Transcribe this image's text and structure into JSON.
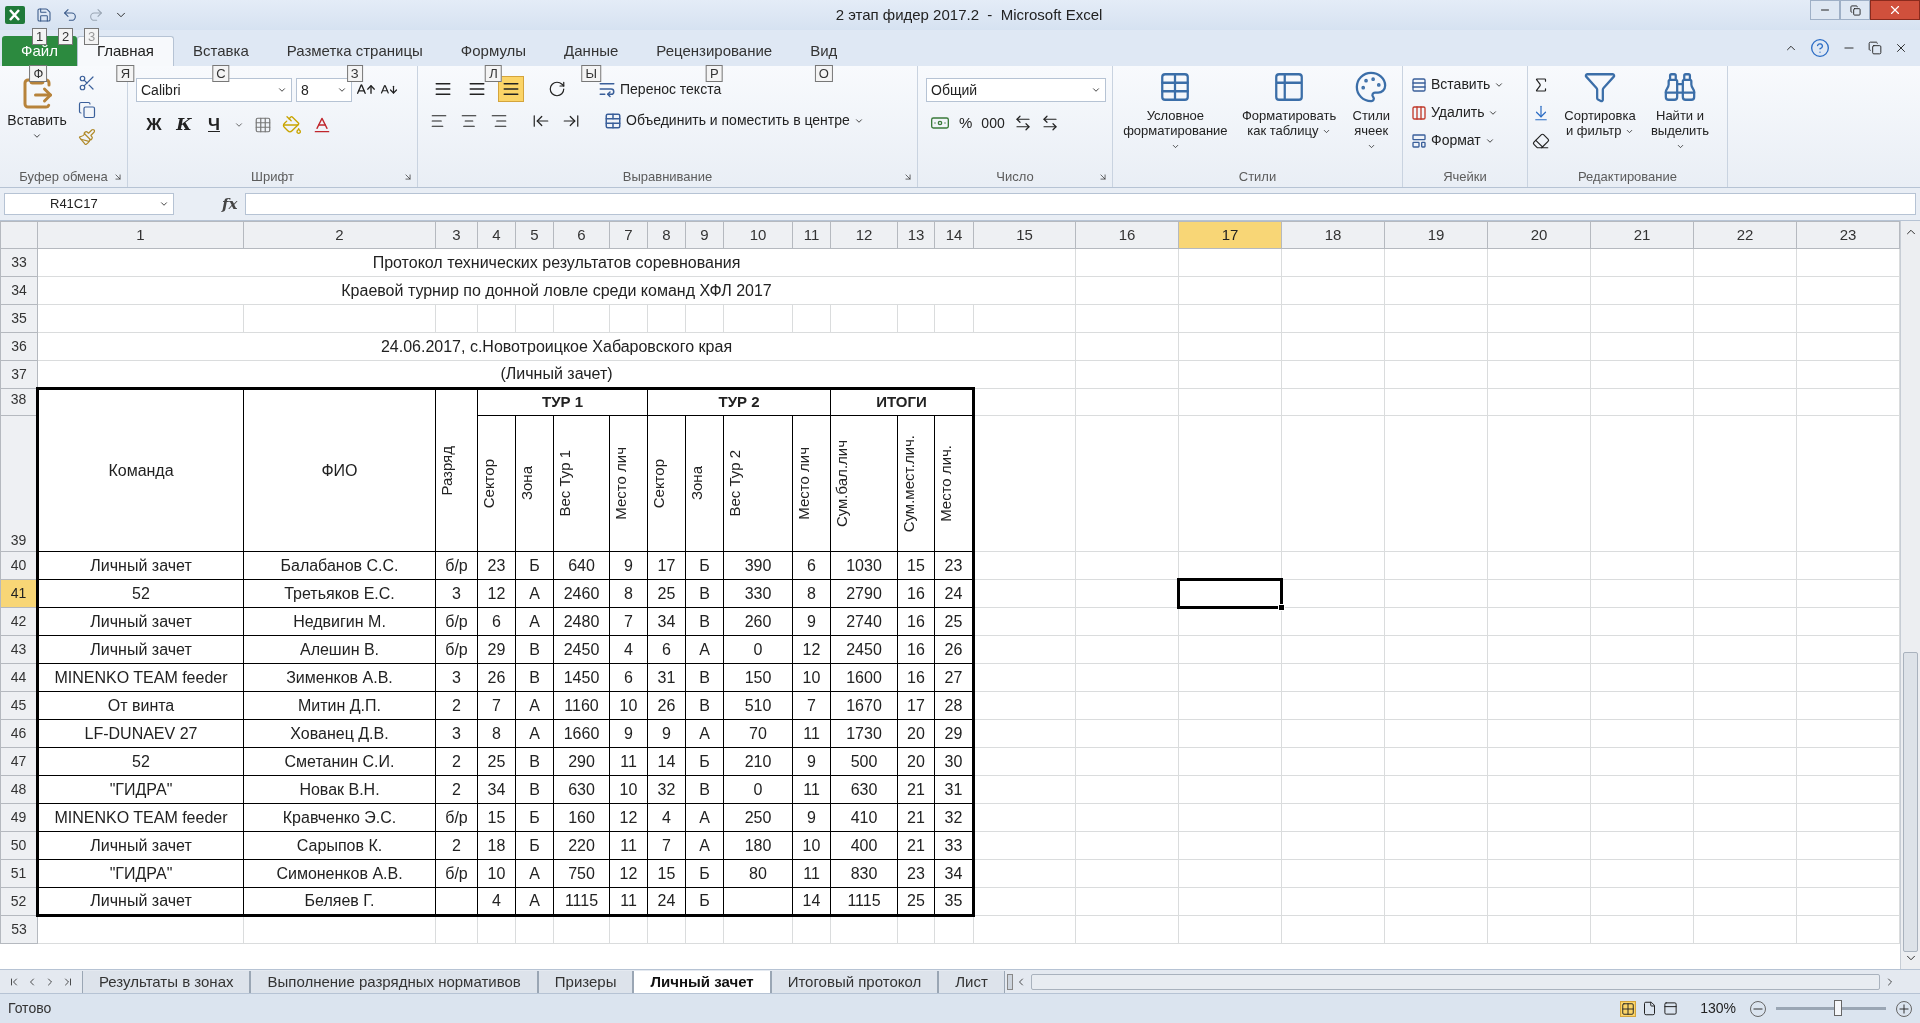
{
  "window": {
    "title": "2 этап фидер 2017.2  -  Microsoft Excel",
    "quick_access_keytips": [
      "1",
      "2",
      "3"
    ]
  },
  "ribbon_tabs": [
    {
      "label": "Файл",
      "keytip": "Ф",
      "kind": "file",
      "selected": false
    },
    {
      "label": "Главная",
      "keytip": "Я",
      "kind": "tab",
      "selected": true
    },
    {
      "label": "Вставка",
      "keytip": "С",
      "kind": "tab",
      "selected": false
    },
    {
      "label": "Разметка страницы",
      "keytip": "З",
      "kind": "tab",
      "selected": false
    },
    {
      "label": "Формулы",
      "keytip": "Л",
      "kind": "tab",
      "selected": false
    },
    {
      "label": "Данные",
      "keytip": "Ы",
      "kind": "tab",
      "selected": false
    },
    {
      "label": "Рецензирование",
      "keytip": "Р",
      "kind": "tab",
      "selected": false
    },
    {
      "label": "Вид",
      "keytip": "О",
      "kind": "tab",
      "selected": false
    }
  ],
  "ribbon": {
    "clipboard": {
      "paste": "Вставить",
      "group": "Буфер обмена"
    },
    "font": {
      "name": "Calibri",
      "size": "8",
      "bold": "Ж",
      "italic": "К",
      "underline": "Ч",
      "group": "Шрифт"
    },
    "alignment": {
      "valign_buttons": [
        {
          "selected": false
        },
        {
          "selected": false
        },
        {
          "selected": true
        }
      ],
      "wrap_text": "Перенос текста",
      "merge": "Объединить и поместить в центре",
      "group": "Выравнивание"
    },
    "number": {
      "format": "Общий",
      "percent": "%",
      "thousands": "000",
      "group": "Число"
    },
    "styles": {
      "buttons": [
        "Условное форматирование",
        "Форматировать как таблицу",
        "Стили ячеек"
      ],
      "group": "Стили"
    },
    "cells": {
      "buttons": [
        "Вставить",
        "Удалить",
        "Формат"
      ],
      "group": "Ячейки"
    },
    "editing": {
      "buttons": [
        "Сортировка и фильтр",
        "Найти и выделить"
      ],
      "group": "Редактирование"
    }
  },
  "formula_bar": {
    "name_box": "R41C17",
    "function_label": "fx"
  },
  "sheet": {
    "columns": [
      {
        "label": "1",
        "selected": false
      },
      {
        "label": "2",
        "selected": false
      },
      {
        "label": "3",
        "selected": false
      },
      {
        "label": "4",
        "selected": false
      },
      {
        "label": "5",
        "selected": false
      },
      {
        "label": "6",
        "selected": false
      },
      {
        "label": "7",
        "selected": false
      },
      {
        "label": "8",
        "selected": false
      },
      {
        "label": "9",
        "selected": false
      },
      {
        "label": "10",
        "selected": false
      },
      {
        "label": "11",
        "selected": false
      },
      {
        "label": "12",
        "selected": false
      },
      {
        "label": "13",
        "selected": false
      },
      {
        "label": "14",
        "selected": false
      },
      {
        "label": "15",
        "selected": false
      },
      {
        "label": "16",
        "selected": false
      },
      {
        "label": "17",
        "selected": true
      },
      {
        "label": "18",
        "selected": false
      },
      {
        "label": "19",
        "selected": false
      },
      {
        "label": "20",
        "selected": false
      },
      {
        "label": "21",
        "selected": false
      },
      {
        "label": "22",
        "selected": false
      },
      {
        "label": "23",
        "selected": false
      }
    ],
    "rows": [
      {
        "number": "33",
        "selected": false,
        "kind": "title",
        "text": "Протокол технических результатов соревнования"
      },
      {
        "number": "34",
        "selected": false,
        "kind": "title",
        "text": "Краевой турнир по донной ловле среди команд ХФЛ 2017"
      },
      {
        "number": "35",
        "selected": false,
        "kind": "blank"
      },
      {
        "number": "36",
        "selected": false,
        "kind": "title",
        "text": "24.06.2017, с.Новотроицкое Хабаровского края"
      },
      {
        "number": "37",
        "selected": false,
        "kind": "title",
        "text": "(Личный зачет)"
      },
      {
        "kind": "header",
        "numbers": [
          "38",
          "39"
        ],
        "selected": false,
        "groups": [
          {
            "kind": "tall",
            "label": "Команда"
          },
          {
            "kind": "tall",
            "label": "ФИО"
          },
          {
            "kind": "tall_rotated",
            "label": "Разряд"
          },
          {
            "kind": "group",
            "label": "ТУР 1",
            "columns": [
              "Сектор",
              "Зона",
              "Вес Тур 1",
              "Место лич"
            ]
          },
          {
            "kind": "group",
            "label": "ТУР 2",
            "columns": [
              "Сектор",
              "Зона",
              "Вес Тур 2",
              "Место лич"
            ]
          },
          {
            "kind": "group",
            "label": "ИТОГИ",
            "columns": [
              "Сум.бал.лич",
              "Сум.мест.лич.",
              "Место лич."
            ]
          }
        ]
      },
      {
        "number": "40",
        "selected": false,
        "kind": "data",
        "cells": [
          "Личный зачет",
          "Балабанов С.С.",
          "б/р",
          "23",
          "Б",
          "640",
          "9",
          "17",
          "Б",
          "390",
          "6",
          "1030",
          "15",
          "23"
        ]
      },
      {
        "number": "41",
        "selected": true,
        "kind": "data",
        "cells": [
          "52",
          "Третьяков Е.С.",
          "3",
          "12",
          "А",
          "2460",
          "8",
          "25",
          "В",
          "330",
          "8",
          "2790",
          "16",
          "24"
        ]
      },
      {
        "number": "42",
        "selected": false,
        "kind": "data",
        "cells": [
          "Личный зачет",
          "Недвигин М.",
          "б/р",
          "6",
          "А",
          "2480",
          "7",
          "34",
          "В",
          "260",
          "9",
          "2740",
          "16",
          "25"
        ]
      },
      {
        "number": "43",
        "selected": false,
        "kind": "data",
        "cells": [
          "Личный зачет",
          "Алешин В.",
          "б/р",
          "29",
          "В",
          "2450",
          "4",
          "6",
          "А",
          "0",
          "12",
          "2450",
          "16",
          "26"
        ]
      },
      {
        "number": "44",
        "selected": false,
        "kind": "data",
        "cells": [
          "MINENKO TEAM feeder",
          "Зименков А.В.",
          "3",
          "26",
          "В",
          "1450",
          "6",
          "31",
          "В",
          "150",
          "10",
          "1600",
          "16",
          "27"
        ]
      },
      {
        "number": "45",
        "selected": false,
        "kind": "data",
        "cells": [
          "От винта",
          "Митин Д.П.",
          "2",
          "7",
          "А",
          "1160",
          "10",
          "26",
          "В",
          "510",
          "7",
          "1670",
          "17",
          "28"
        ]
      },
      {
        "number": "46",
        "selected": false,
        "kind": "data",
        "cells": [
          "LF-DUNAEV 27",
          "Хованец Д.В.",
          "3",
          "8",
          "А",
          "1660",
          "9",
          "9",
          "А",
          "70",
          "11",
          "1730",
          "20",
          "29"
        ]
      },
      {
        "number": "47",
        "selected": false,
        "kind": "data",
        "cells": [
          "52",
          "Сметанин С.И.",
          "2",
          "25",
          "В",
          "290",
          "11",
          "14",
          "Б",
          "210",
          "9",
          "500",
          "20",
          "30"
        ]
      },
      {
        "number": "48",
        "selected": false,
        "kind": "data",
        "cells": [
          "\"ГИДРА\"",
          "Новак В.Н.",
          "2",
          "34",
          "В",
          "630",
          "10",
          "32",
          "В",
          "0",
          "11",
          "630",
          "21",
          "31"
        ]
      },
      {
        "number": "49",
        "selected": false,
        "kind": "data",
        "cells": [
          "MINENKO TEAM feeder",
          "Кравченко Э.С.",
          "б/р",
          "15",
          "Б",
          "160",
          "12",
          "4",
          "А",
          "250",
          "9",
          "410",
          "21",
          "32"
        ]
      },
      {
        "number": "50",
        "selected": false,
        "kind": "data",
        "cells": [
          "Личный зачет",
          "Сарыпов К.",
          "2",
          "18",
          "Б",
          "220",
          "11",
          "7",
          "А",
          "180",
          "10",
          "400",
          "21",
          "33"
        ]
      },
      {
        "number": "51",
        "selected": false,
        "kind": "data",
        "cells": [
          "\"ГИДРА\"",
          "Симоненков А.В.",
          "б/р",
          "10",
          "А",
          "750",
          "12",
          "15",
          "Б",
          "80",
          "11",
          "830",
          "23",
          "34"
        ]
      },
      {
        "number": "52",
        "selected": false,
        "kind": "data",
        "cells": [
          "Личный зачет",
          "Беляев Г.",
          null,
          "4",
          "А",
          "1115",
          "11",
          "24",
          "Б",
          null,
          "14",
          "1115",
          "25",
          "35"
        ]
      },
      {
        "number": "53",
        "selected": false,
        "kind": "blank"
      }
    ]
  },
  "sheet_tabs": [
    {
      "label": "Результаты в зонах",
      "selected": false
    },
    {
      "label": "Выполнение разрядных нормативов",
      "selected": false
    },
    {
      "label": "Призеры",
      "selected": false
    },
    {
      "label": "Личный зачет",
      "selected": true
    },
    {
      "label": "Итоговый протокол",
      "selected": false
    },
    {
      "label": "Лист",
      "selected": false
    }
  ],
  "status_bar": {
    "status": "Готово",
    "zoom": "130%",
    "zoom_slider": {
      "level": 0.56
    }
  }
}
